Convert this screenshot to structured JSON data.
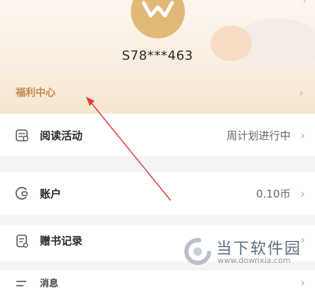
{
  "profile": {
    "username": "S78***463"
  },
  "welfare": {
    "label": "福利中心"
  },
  "menu": {
    "reading_activity": {
      "label": "阅读活动",
      "status": "周计划进行中"
    },
    "account": {
      "label": "账户",
      "balance": "0.10币"
    },
    "book_records": {
      "label": "赠书记录"
    },
    "partial_item": {
      "label": "消息"
    }
  },
  "watermark": {
    "name": "当下软件园",
    "url": "www.downxia.com"
  },
  "icons": {
    "reading": "calendar-list-icon",
    "account": "wallet-icon",
    "book_records": "receipt-icon",
    "partial": "message-icon",
    "chevron": "chevron-right-icon"
  },
  "colors": {
    "welfare_text": "#c5894a",
    "avatar": "#e0b977",
    "annotation_arrow": "#e23c3c"
  }
}
